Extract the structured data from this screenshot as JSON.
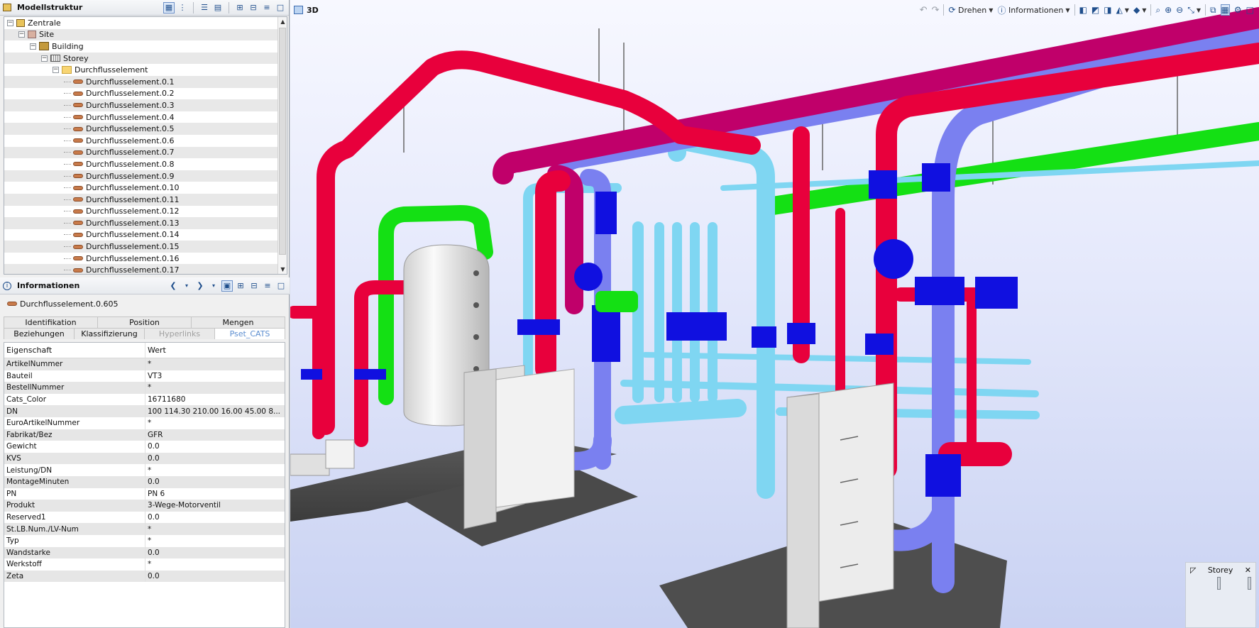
{
  "tree_panel": {
    "title": "Modellstruktur",
    "nodes": [
      {
        "label": "Zentrale",
        "icon": "home-icon",
        "indent": 0,
        "expander": "−"
      },
      {
        "label": "Site",
        "icon": "site-icon",
        "indent": 1,
        "expander": "−"
      },
      {
        "label": "Building",
        "icon": "building-icon",
        "indent": 2,
        "expander": "−"
      },
      {
        "label": "Storey",
        "icon": "storey-icon",
        "indent": 3,
        "expander": "−"
      },
      {
        "label": "Durchflusselement",
        "icon": "folder-icon",
        "indent": 4,
        "expander": "−"
      },
      {
        "label": "Durchflusselement.0.1",
        "icon": "pipe-icon",
        "indent": 5
      },
      {
        "label": "Durchflusselement.0.2",
        "icon": "pipe-icon",
        "indent": 5
      },
      {
        "label": "Durchflusselement.0.3",
        "icon": "pipe-icon",
        "indent": 5
      },
      {
        "label": "Durchflusselement.0.4",
        "icon": "pipe-icon",
        "indent": 5
      },
      {
        "label": "Durchflusselement.0.5",
        "icon": "pipe-icon",
        "indent": 5
      },
      {
        "label": "Durchflusselement.0.6",
        "icon": "pipe-icon",
        "indent": 5
      },
      {
        "label": "Durchflusselement.0.7",
        "icon": "pipe-icon",
        "indent": 5
      },
      {
        "label": "Durchflusselement.0.8",
        "icon": "pipe-icon",
        "indent": 5
      },
      {
        "label": "Durchflusselement.0.9",
        "icon": "pipe-icon",
        "indent": 5
      },
      {
        "label": "Durchflusselement.0.10",
        "icon": "pipe-icon",
        "indent": 5
      },
      {
        "label": "Durchflusselement.0.11",
        "icon": "pipe-icon",
        "indent": 5
      },
      {
        "label": "Durchflusselement.0.12",
        "icon": "pipe-icon",
        "indent": 5
      },
      {
        "label": "Durchflusselement.0.13",
        "icon": "pipe-icon",
        "indent": 5
      },
      {
        "label": "Durchflusselement.0.14",
        "icon": "pipe-icon",
        "indent": 5
      },
      {
        "label": "Durchflusselement.0.15",
        "icon": "pipe-icon",
        "indent": 5
      },
      {
        "label": "Durchflusselement.0.16",
        "icon": "pipe-icon",
        "indent": 5
      },
      {
        "label": "Durchflusselement.0.17",
        "icon": "pipe-icon",
        "indent": 5
      }
    ]
  },
  "info_panel": {
    "title": "Informationen",
    "selected": "Durchflusselement.0.605",
    "tabs_row1": [
      "Identifikation",
      "Position",
      "Mengen"
    ],
    "tabs_row2": [
      "Beziehungen",
      "Klassifizierung",
      "Hyperlinks",
      "Pset_CATS"
    ],
    "active_tab": "Pset_CATS",
    "columns": [
      "Eigenschaft",
      "Wert"
    ],
    "properties": [
      {
        "name": "ArtikelNummer",
        "value": "*"
      },
      {
        "name": "Bauteil",
        "value": "VT3"
      },
      {
        "name": "BestellNummer",
        "value": "*"
      },
      {
        "name": "Cats_Color",
        "value": "16711680"
      },
      {
        "name": "DN",
        "value": "100   114.30   210.00   16.00   45.00   8..."
      },
      {
        "name": "EuroArtikelNummer",
        "value": "*"
      },
      {
        "name": "Fabrikat/Bez",
        "value": "GFR"
      },
      {
        "name": "Gewicht",
        "value": "0.0"
      },
      {
        "name": "KVS",
        "value": "0.0"
      },
      {
        "name": "Leistung/DN",
        "value": "*"
      },
      {
        "name": "MontageMinuten",
        "value": "0.0"
      },
      {
        "name": "PN",
        "value": "PN 6"
      },
      {
        "name": "Produkt",
        "value": "3-Wege-Motorventil"
      },
      {
        "name": "Reserved1",
        "value": "0.0"
      },
      {
        "name": "St.LB.Num./LV-Num",
        "value": "*"
      },
      {
        "name": "Typ",
        "value": "*"
      },
      {
        "name": "Wandstarke",
        "value": "0.0"
      },
      {
        "name": "Werkstoff",
        "value": "*"
      },
      {
        "name": "Zeta",
        "value": "0.0"
      }
    ]
  },
  "view": {
    "tab_label": "3D",
    "toolbar": {
      "rotate_label": "Drehen",
      "info_label": "Informationen"
    },
    "storey_box": {
      "title": "Storey"
    },
    "colors": {
      "hot_pipe": "#e8003c",
      "return_pipe": "#c0006a",
      "cold_pipe": "#7a80f0",
      "chilled_pipe": "#7fd6f2",
      "green_pipe": "#14e014",
      "valve": "#1010e0",
      "tank": "#e8e8e8",
      "floor": "#4e4e4e"
    }
  }
}
